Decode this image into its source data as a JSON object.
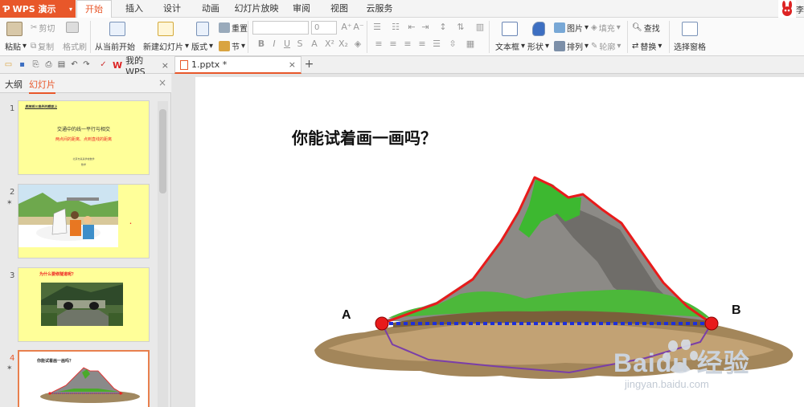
{
  "app": {
    "name": "WPS 演示",
    "user_name": "李"
  },
  "menu_tabs": [
    "开始",
    "插入",
    "设计",
    "动画",
    "幻灯片放映",
    "审阅",
    "视图",
    "云服务"
  ],
  "ribbon": {
    "paste": "粘贴",
    "cut": "剪切",
    "copy": "复制",
    "format_painter": "格式刷",
    "from_current": "从当前开始",
    "new_slide": "新建幻灯片",
    "layout": "版式",
    "reset": "重置",
    "section": "节",
    "font_size": "0",
    "text_box": "文本框",
    "shape": "形状",
    "picture": "图片",
    "fill": "填充",
    "arrange": "排列",
    "outline": "轮廓",
    "find": "查找",
    "replace": "替换",
    "selection_pane": "选择窗格"
  },
  "doc_tabs": {
    "home": "我的WPS",
    "file": "1.pptx *"
  },
  "left_panel": {
    "tab_outline": "大纲",
    "tab_slides": "幻灯片",
    "slides": [
      {
        "number": "1",
        "top": "直接观三角形的截面上",
        "title": "交通中的线一平行与相交",
        "subtitle": "两点间的距离、点到直线的距离",
        "foot1": "北京市某某学校数学",
        "foot2": "数学"
      },
      {
        "number": "2"
      },
      {
        "number": "3",
        "title": "为什么要修隧道呢？"
      },
      {
        "number": "4",
        "title": "你能试着画一画吗？"
      }
    ]
  },
  "slide": {
    "title": "你能试着画一画吗？",
    "label_a": "A",
    "label_b": "B"
  },
  "watermark": {
    "brand": "Baidu 经验",
    "url": "jingyan.baidu.com"
  }
}
